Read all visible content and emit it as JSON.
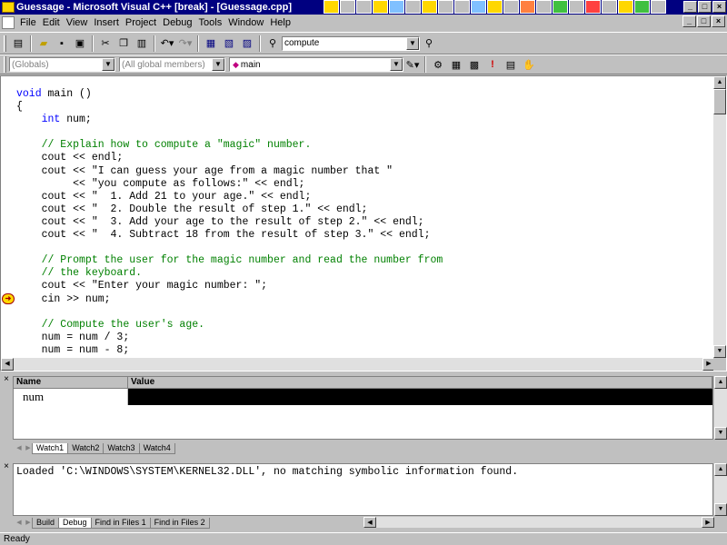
{
  "window": {
    "title": "Guessage - Microsoft Visual C++ [break] - [Guessage.cpp]"
  },
  "menu": [
    "File",
    "Edit",
    "View",
    "Insert",
    "Project",
    "Debug",
    "Tools",
    "Window",
    "Help"
  ],
  "toolbar": {
    "find_value": "compute"
  },
  "wizardbar": {
    "scope": "(Globals)",
    "filter": "(All global members)",
    "member": "main"
  },
  "code_lines": [
    {
      "t": "void main ()",
      "c": "kw-first"
    },
    {
      "t": "{",
      "c": ""
    },
    {
      "t": "    int num;",
      "c": "kw-int"
    },
    {
      "t": "",
      "c": ""
    },
    {
      "t": "    // Explain how to compute a \"magic\" number.",
      "c": "cm"
    },
    {
      "t": "    cout << endl;",
      "c": ""
    },
    {
      "t": "    cout << \"I can guess your age from a magic number that \"",
      "c": ""
    },
    {
      "t": "         << \"you compute as follows:\" << endl;",
      "c": ""
    },
    {
      "t": "    cout << \"  1. Add 21 to your age.\" << endl;",
      "c": ""
    },
    {
      "t": "    cout << \"  2. Double the result of step 1.\" << endl;",
      "c": ""
    },
    {
      "t": "    cout << \"  3. Add your age to the result of step 2.\" << endl;",
      "c": ""
    },
    {
      "t": "    cout << \"  4. Subtract 18 from the result of step 3.\" << endl;",
      "c": ""
    },
    {
      "t": "",
      "c": ""
    },
    {
      "t": "    // Prompt the user for the magic number and read the number from",
      "c": "cm"
    },
    {
      "t": "    // the keyboard.",
      "c": "cm"
    },
    {
      "t": "    cout << \"Enter your magic number: \";",
      "c": ""
    },
    {
      "t": "    cin >> num;",
      "c": ""
    },
    {
      "t": "",
      "c": ""
    },
    {
      "t": "    // Compute the user's age.",
      "c": "cm"
    },
    {
      "t": "    num = num / 3;",
      "c": ""
    },
    {
      "t": "    num = num - 8;",
      "c": ""
    }
  ],
  "watch": {
    "headers": {
      "name": "Name",
      "value": "Value"
    },
    "row": {
      "name": "num",
      "value": ""
    },
    "tabs": [
      "Watch1",
      "Watch2",
      "Watch3",
      "Watch4"
    ]
  },
  "output": {
    "text": "Loaded 'C:\\WINDOWS\\SYSTEM\\KERNEL32.DLL', no matching symbolic information found.",
    "tabs": [
      "Build",
      "Debug",
      "Find in Files 1",
      "Find in Files 2"
    ]
  },
  "status": {
    "text": "Ready"
  }
}
